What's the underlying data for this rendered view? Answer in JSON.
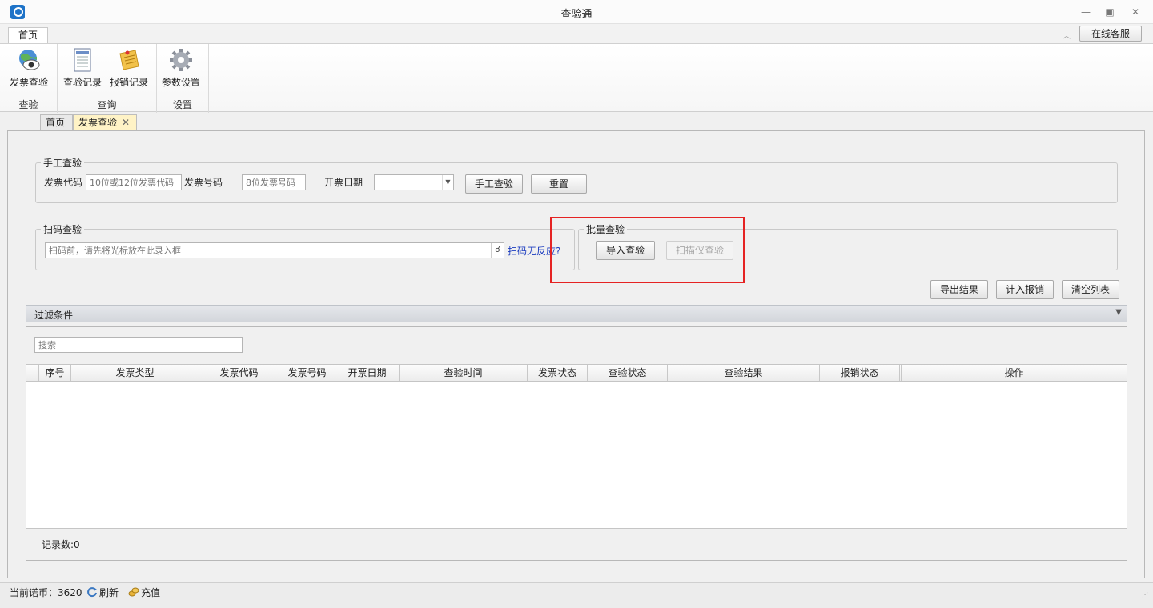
{
  "window": {
    "title": "查验通"
  },
  "ribbon_tabs": {
    "home": "首页",
    "online_service": "在线客服"
  },
  "ribbon": {
    "groups": [
      {
        "label": "查验",
        "buttons": [
          {
            "label": "发票查验",
            "icon": "globe-eye-icon"
          }
        ]
      },
      {
        "label": "查询",
        "buttons": [
          {
            "label": "查验记录",
            "icon": "document-list-icon"
          },
          {
            "label": "报销记录",
            "icon": "sticky-note-icon"
          }
        ]
      },
      {
        "label": "设置",
        "buttons": [
          {
            "label": "参数设置",
            "icon": "gear-icon"
          }
        ]
      }
    ]
  },
  "doc_tabs": {
    "home": "首页",
    "invoice_check": "发票查验",
    "close": "✕"
  },
  "manual": {
    "legend": "手工查验",
    "code_label": "发票代码",
    "code_placeholder": "10位或12位发票代码",
    "number_label": "发票号码",
    "number_placeholder": "8位发票号码",
    "date_label": "开票日期",
    "check_btn": "手工查验",
    "reset_btn": "重置"
  },
  "scan": {
    "legend": "扫码查验",
    "placeholder": "扫码前，请先将光标放在此录入框",
    "no_response_link": "扫码无反应?"
  },
  "batch": {
    "legend": "批量查验",
    "import_btn": "导入查验",
    "scanner_btn": "扫描仪查验"
  },
  "actions": {
    "export": "导出结果",
    "add_reimburse": "计入报销",
    "clear": "清空列表"
  },
  "filter": {
    "title": "过滤条件"
  },
  "grid": {
    "search_placeholder": "搜索",
    "columns": [
      "序号",
      "发票类型",
      "发票代码",
      "发票号码",
      "开票日期",
      "查验时间",
      "发票状态",
      "查验状态",
      "查验结果",
      "报销状态",
      "操作"
    ],
    "rows": [],
    "record_count": "记录数:0"
  },
  "status": {
    "coins": "当前诺币：3620",
    "refresh": "刷新",
    "recharge": "充值"
  },
  "colors": {
    "highlight": "#e52323",
    "active_tab": "#fff3c6",
    "link": "#1a3bbf"
  }
}
